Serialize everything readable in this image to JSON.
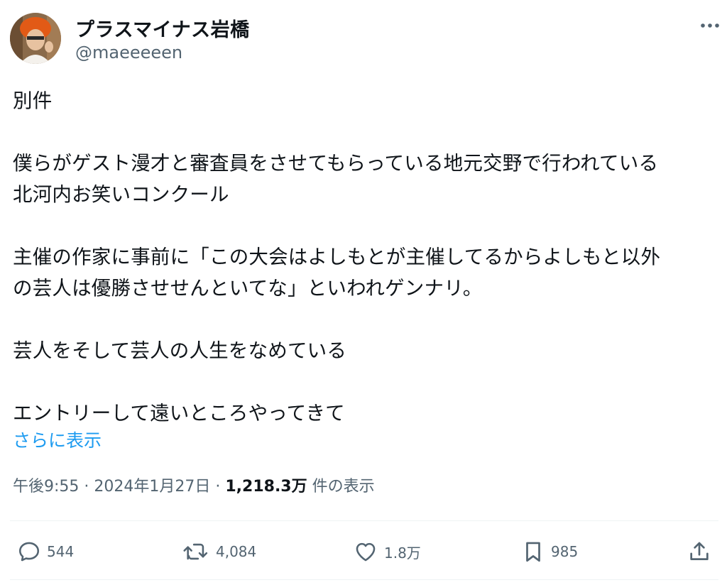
{
  "author": {
    "name": "プラスマイナス岩橋",
    "handle": "@maeeeeen"
  },
  "tweet": {
    "lines": [
      "別件",
      "",
      "僕らがゲスト漫才と審査員をさせてもらっている地元交野で行われている",
      "北河内お笑いコンクール",
      "",
      "主催の作家に事前に「この大会はよしもとが主催してるからよしもと以外",
      "の芸人は優勝させせんといてな」といわれゲンナリ。",
      "",
      "芸人をそして芸人の人生をなめている",
      "",
      "エントリーして遠いところやってきて"
    ],
    "show_more": "さらに表示"
  },
  "meta": {
    "time": "午後9:55",
    "separator": " · ",
    "date": "2024年1月27日",
    "views_count": "1,218.3万",
    "views_label": "件の表示"
  },
  "actions": {
    "reply_count": "544",
    "retweet_count": "4,084",
    "like_count": "1.8万",
    "bookmark_count": "985"
  },
  "icons": {
    "more": "more-horizontal-icon",
    "reply": "speech-bubble-icon",
    "retweet": "retweet-arrows-icon",
    "like": "heart-icon",
    "bookmark": "bookmark-icon",
    "share": "share-upload-icon"
  },
  "colors": {
    "text": "#0f1419",
    "secondary": "#536471",
    "link": "#1d9bf0",
    "divider": "#eff3f4"
  }
}
